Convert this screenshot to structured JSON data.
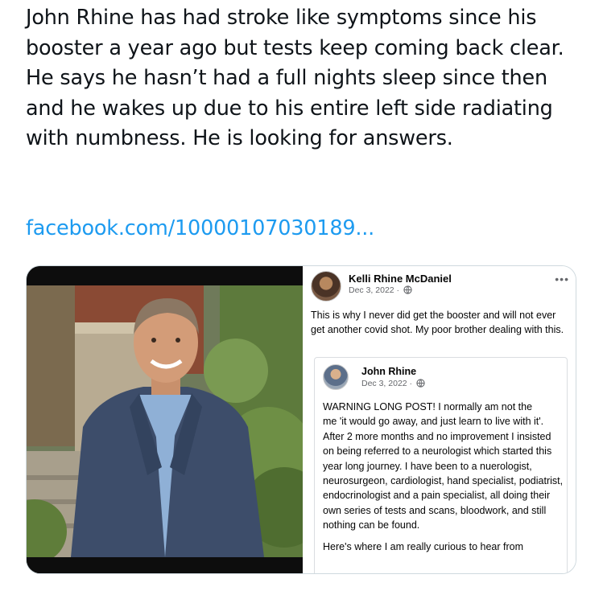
{
  "tweet": {
    "text": "John Rhine has had stroke like symptoms since his booster a year ago but tests keep coming back clear. He says he hasn’t had a full nights sleep since then and he wakes up due to his entire left side radiating with numbness. He is looking for answers.",
    "link": "facebook.com/10000107030189..."
  },
  "fb_post": {
    "author": "Kelli Rhine McDaniel",
    "date": "Dec 3, 2022 ·",
    "privacy_icon": "globe-icon",
    "more_icon": "more-horizontal-icon",
    "more_glyph": "•••",
    "body": "This is why I never did get the booster and will not ever get another covid shot. My poor brother dealing with this."
  },
  "shared_post": {
    "author": "John Rhine",
    "date": "Dec 3, 2022 ·",
    "privacy_icon": "globe-icon",
    "para1": "WARNING LONG POST!  I normally am not the",
    "para2": "me 'it would go away, and just learn to live with it'.  After 2 more months and no improvement I insisted on being referred to a neurologist which started this year long journey.  I have been to a nuerologist, neurosurgeon, cardiologist, hand specialist, podiatrist, endocrinologist and a pain specialist, all doing their own series of tests and scans, bloodwork, and still nothing can be found.",
    "para3": "Here's where I am really curious to hear from"
  }
}
